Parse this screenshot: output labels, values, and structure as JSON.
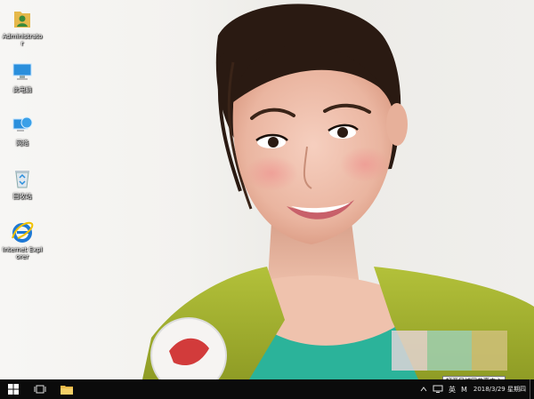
{
  "desktop": {
    "icons": [
      {
        "label": "Administrator",
        "icon": "user-folder-icon"
      },
      {
        "label": "此电脑",
        "icon": "computer-icon"
      },
      {
        "label": "网络",
        "icon": "network-icon"
      },
      {
        "label": "回收站",
        "icon": "recycle-bin-icon"
      },
      {
        "label": "Internet Explorer",
        "icon": "internet-explorer-icon"
      }
    ]
  },
  "tooltip": {
    "text": "打开局域网共享中心"
  },
  "taskbar": {
    "buttons": [
      {
        "name": "start",
        "icon": "windows-logo-icon"
      },
      {
        "name": "task-view",
        "icon": "task-view-icon"
      },
      {
        "name": "file-explorer",
        "icon": "folder-icon"
      }
    ],
    "tray": {
      "network_icon": "network-icon",
      "ime": "英",
      "ime_mode": "M",
      "date": "2018/3/29",
      "weekday": "星期四"
    }
  },
  "colors": {
    "taskbar_bg": "#0b0b0b",
    "sweater": "#a7b52f",
    "shirt": "#2bb39a"
  }
}
